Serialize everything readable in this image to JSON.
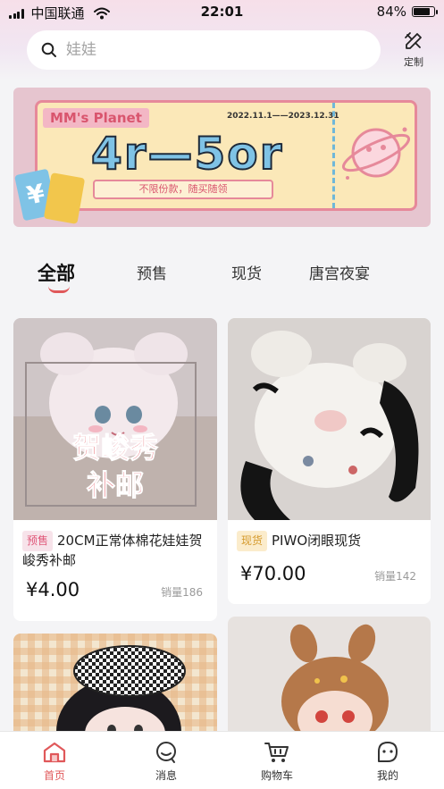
{
  "status_bar": {
    "carrier": "中国联通",
    "time": "22:01",
    "battery": "84%",
    "battery_level": 0.84
  },
  "search": {
    "placeholder": "娃娃",
    "custom_label": "定制"
  },
  "banner": {
    "title": "MM's Planet",
    "date_range": "2022.11.1——2023.12.31",
    "headline": "4r—5or",
    "subtitle": "不限份款，随买随领",
    "yen_symbol": "¥"
  },
  "tabs": [
    {
      "label": "全部",
      "active": true
    },
    {
      "label": "预售",
      "active": false
    },
    {
      "label": "现货",
      "active": false
    },
    {
      "label": "唐宫夜宴",
      "active": false
    }
  ],
  "products": [
    {
      "image_text_line1": "贺峻秀",
      "image_text_line2": "补邮",
      "tag": "预售",
      "title": "20CM正常体棉花娃娃贺峻秀补邮",
      "price": "¥4.00",
      "sales": "销量186"
    },
    {
      "tag": "现货",
      "title": "PIWO闭眼现货",
      "price": "¥70.00",
      "sales": "销量142"
    },
    {},
    {}
  ],
  "bottom_nav": [
    {
      "label": "首页",
      "icon": "home-icon",
      "active": true
    },
    {
      "label": "消息",
      "icon": "message-icon",
      "active": false
    },
    {
      "label": "购物车",
      "icon": "cart-icon",
      "active": false
    },
    {
      "label": "我的",
      "icon": "profile-icon",
      "active": false
    }
  ],
  "colors": {
    "accent": "#e0585a",
    "presale_tag_bg": "#f7e3ea",
    "presale_tag_text": "#e0587a",
    "instock_tag_bg": "#fbeccc",
    "instock_tag_text": "#d59a2c"
  }
}
